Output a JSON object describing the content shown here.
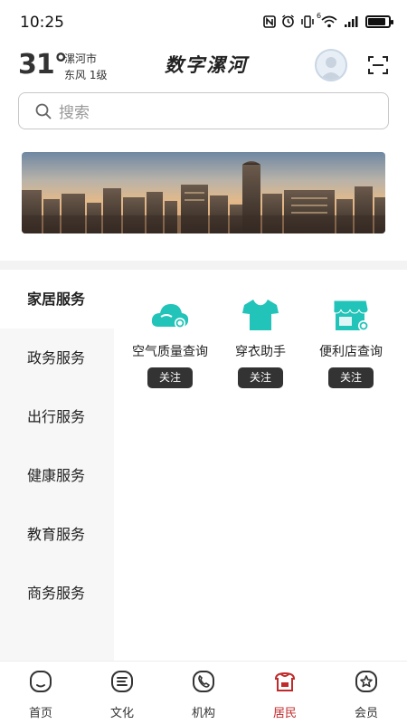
{
  "status_bar": {
    "time": "10:25",
    "icons": [
      "nfc-icon",
      "alarm-icon",
      "vibrate-icon",
      "wifi-icon",
      "signal-icon",
      "battery-icon"
    ],
    "wifi_tag": "6",
    "battery_level": 0.85
  },
  "header": {
    "temperature": "31°",
    "city": "漯河市",
    "wind": "东风 1级",
    "title": "数字漯河"
  },
  "search": {
    "placeholder": "搜索"
  },
  "sidebar": {
    "items": [
      {
        "label": "家居服务",
        "active": true
      },
      {
        "label": "政务服务",
        "active": false
      },
      {
        "label": "出行服务",
        "active": false
      },
      {
        "label": "健康服务",
        "active": false
      },
      {
        "label": "教育服务",
        "active": false
      },
      {
        "label": "商务服务",
        "active": false
      }
    ]
  },
  "services": [
    {
      "label": "空气质量查询",
      "icon": "cloud-icon",
      "button": "关注"
    },
    {
      "label": "穿衣助手",
      "icon": "tshirt-icon",
      "button": "关注"
    },
    {
      "label": "便利店查询",
      "icon": "store-icon",
      "button": "关注"
    }
  ],
  "tabbar": {
    "items": [
      {
        "label": "首页",
        "icon": "home-icon",
        "active": false
      },
      {
        "label": "文化",
        "icon": "culture-icon",
        "active": false
      },
      {
        "label": "机构",
        "icon": "phone-icon",
        "active": false
      },
      {
        "label": "居民",
        "icon": "resident-icon",
        "active": true
      },
      {
        "label": "会员",
        "icon": "member-icon",
        "active": false
      }
    ]
  },
  "colors": {
    "accent": "#c02a2a",
    "service_icon": "#22c3b8",
    "button_bg": "#333333"
  }
}
